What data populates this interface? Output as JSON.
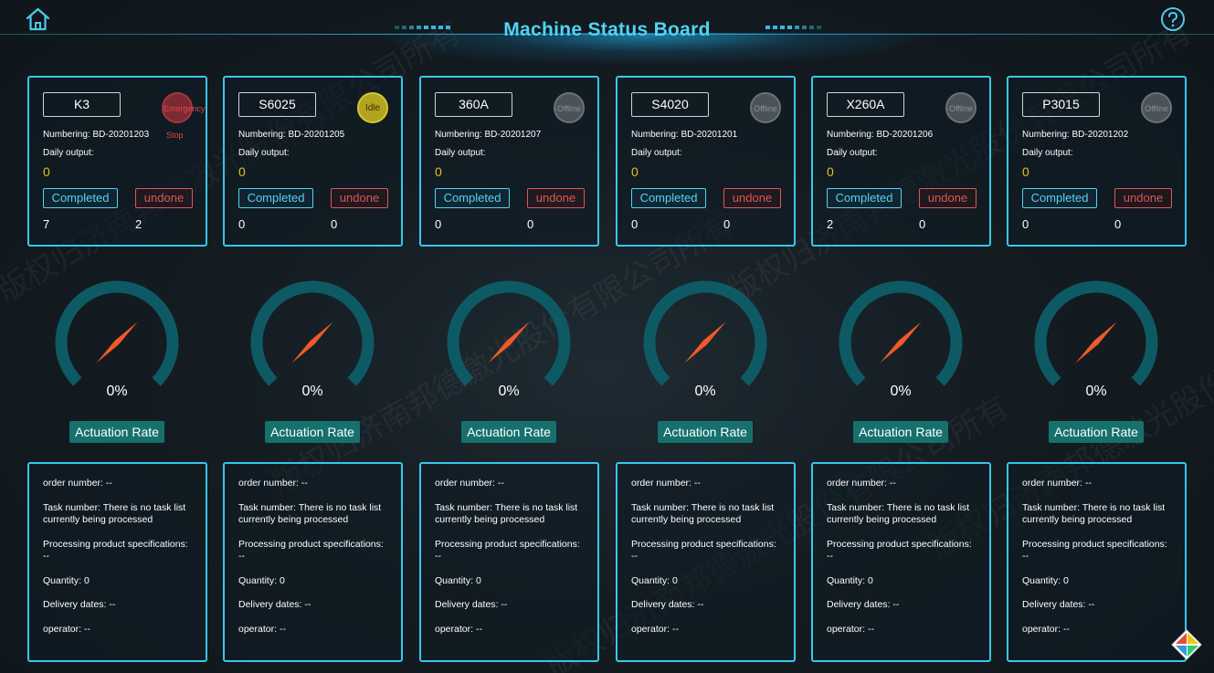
{
  "header": {
    "title": "Machine Status Board"
  },
  "machines": [
    {
      "name": "K3",
      "status": "Emergency",
      "status_sub": "Stop",
      "status_type": "emergency",
      "numbering": "Numbering: BD-20201203",
      "daily_output_label": "Daily output:",
      "daily_output": "0",
      "completed_label": "Completed",
      "undone_label": "undone",
      "completed_count": "7",
      "undone_count": "2",
      "gauge_value": "0%",
      "gauge_fraction": 0,
      "rate_label": "Actuation Rate",
      "order_number": "order number: --",
      "task_number": "Task number: There is no task list currently being processed",
      "spec_label": "Processing product specifications:",
      "spec_value": "--",
      "quantity": "Quantity: 0",
      "delivery": "Delivery dates: --",
      "operator": "operator: --"
    },
    {
      "name": "S6025",
      "status": "Idle",
      "status_sub": "",
      "status_type": "idle",
      "numbering": "Numbering: BD-20201205",
      "daily_output_label": "Daily output:",
      "daily_output": "0",
      "completed_label": "Completed",
      "undone_label": "undone",
      "completed_count": "0",
      "undone_count": "0",
      "gauge_value": "0%",
      "gauge_fraction": 0,
      "rate_label": "Actuation Rate",
      "order_number": "order number: --",
      "task_number": "Task number: There is no task list currently being processed",
      "spec_label": "Processing product specifications:",
      "spec_value": "--",
      "quantity": "Quantity: 0",
      "delivery": "Delivery dates: --",
      "operator": "operator: --"
    },
    {
      "name": "360A",
      "status": "Offline",
      "status_sub": "",
      "status_type": "offline",
      "numbering": "Numbering: BD-20201207",
      "daily_output_label": "Daily output:",
      "daily_output": "0",
      "completed_label": "Completed",
      "undone_label": "undone",
      "completed_count": "0",
      "undone_count": "0",
      "gauge_value": "0%",
      "gauge_fraction": 0,
      "rate_label": "Actuation Rate",
      "order_number": "order number: --",
      "task_number": "Task number: There is no task list currently being processed",
      "spec_label": "Processing product specifications:",
      "spec_value": "--",
      "quantity": "Quantity: 0",
      "delivery": "Delivery dates: --",
      "operator": "operator: --"
    },
    {
      "name": "S4020",
      "status": "Offline",
      "status_sub": "",
      "status_type": "offline",
      "numbering": "Numbering: BD-20201201",
      "daily_output_label": "Daily output:",
      "daily_output": "0",
      "completed_label": "Completed",
      "undone_label": "undone",
      "completed_count": "0",
      "undone_count": "0",
      "gauge_value": "0%",
      "gauge_fraction": 0,
      "rate_label": "Actuation Rate",
      "order_number": "order number: --",
      "task_number": "Task number: There is no task list currently being processed",
      "spec_label": "Processing product specifications:",
      "spec_value": "--",
      "quantity": "Quantity: 0",
      "delivery": "Delivery dates: --",
      "operator": "operator: --"
    },
    {
      "name": "X260A",
      "status": "Offline",
      "status_sub": "",
      "status_type": "offline",
      "numbering": "Numbering: BD-20201206",
      "daily_output_label": "Daily output:",
      "daily_output": "0",
      "completed_label": "Completed",
      "undone_label": "undone",
      "completed_count": "2",
      "undone_count": "0",
      "gauge_value": "0%",
      "gauge_fraction": 0,
      "rate_label": "Actuation Rate",
      "order_number": "order number: --",
      "task_number": "Task number: There is no task list currently being processed",
      "spec_label": "Processing product specifications:",
      "spec_value": "--",
      "quantity": "Quantity: 0",
      "delivery": "Delivery dates: --",
      "operator": "operator: --"
    },
    {
      "name": "P3015",
      "status": "Offline",
      "status_sub": "",
      "status_type": "offline",
      "numbering": "Numbering: BD-20201202",
      "daily_output_label": "Daily output:",
      "daily_output": "0",
      "completed_label": "Completed",
      "undone_label": "undone",
      "completed_count": "0",
      "undone_count": "0",
      "gauge_value": "0%",
      "gauge_fraction": 0,
      "rate_label": "Actuation Rate",
      "order_number": "order number: --",
      "task_number": "Task number: There is no task list currently being processed",
      "spec_label": "Processing product specifications:",
      "spec_value": "--",
      "quantity": "Quantity: 0",
      "delivery": "Delivery dates: --",
      "operator": "operator: --"
    }
  ],
  "watermark_text": "版权归济南邦德激光股份有限公司所有",
  "icons": {
    "home": "home-icon",
    "help": "help-icon",
    "corner": "app-logo-icon"
  },
  "colors": {
    "accent": "#39c6ec",
    "title": "#4fd4f5",
    "completed": "#4fd4f5",
    "undone": "#e25454",
    "daily_output": "#e0c21c",
    "gauge_track": "#0e5a64",
    "gauge_needle": "#f05a28",
    "rate_label_bg": "#16706c",
    "emergency": "#a6353f",
    "idle": "#d6c633",
    "offline": "#6a7279"
  }
}
